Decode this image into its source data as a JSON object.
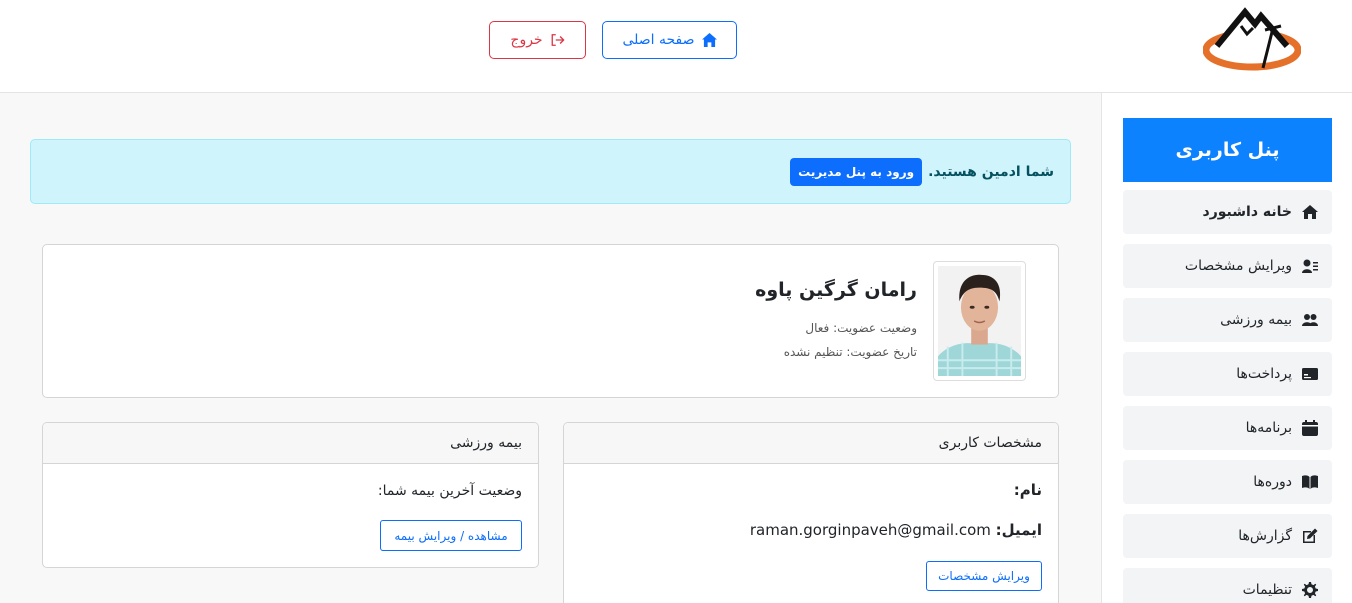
{
  "header": {
    "home_label": "صفحه اصلی",
    "logout_label": "خروج"
  },
  "sidebar": {
    "title": "پنل کاربری",
    "items": [
      {
        "label": "خانه داشبورد",
        "icon": "home-icon"
      },
      {
        "label": "ویرایش مشخصات",
        "icon": "user-edit-icon"
      },
      {
        "label": "بیمه ورزشی",
        "icon": "users-icon"
      },
      {
        "label": "پرداخت‌ها",
        "icon": "card-icon"
      },
      {
        "label": "برنامه‌ها",
        "icon": "calendar-icon"
      },
      {
        "label": "دوره‌ها",
        "icon": "book-icon"
      },
      {
        "label": "گزارش‌ها",
        "icon": "pen-square-icon"
      },
      {
        "label": "تنظیمات",
        "icon": "gear-icon"
      }
    ]
  },
  "alert": {
    "text": "شما ادمین هستید.",
    "button": "ورود به پنل مدیریت"
  },
  "profile": {
    "name": "رامان گرگین پاوه",
    "status": "وضعیت عضویت: فعال",
    "date": "تاریخ عضویت: تنظیم نشده"
  },
  "user_card": {
    "title": "مشخصات کاربری",
    "name_label": "نام:",
    "email_label": "ایمیل:",
    "email_value": "raman.gorginpaveh@gmail.com",
    "edit_button": "ویرایش مشخصات"
  },
  "insurance_card": {
    "title": "بیمه ورزشی",
    "status_text": "وضعیت آخرین بیمه شما:",
    "button": "مشاهده / ویرایش بیمه"
  },
  "colors": {
    "primary": "#0d6efd",
    "panel_title_bg": "#0d82ff",
    "danger": "#dc3545",
    "alert_bg": "#cff4fc",
    "logo_orange": "#e5702a"
  }
}
